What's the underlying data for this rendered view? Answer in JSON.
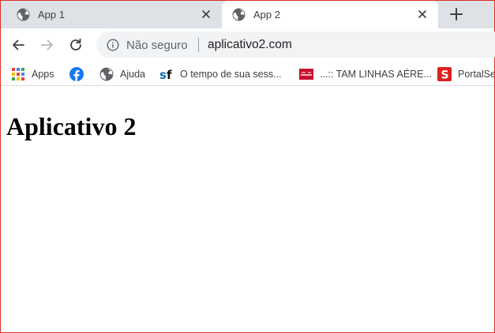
{
  "tabs": [
    {
      "title": "App 1",
      "active": false
    },
    {
      "title": "App 2",
      "active": true
    }
  ],
  "toolbar": {
    "security_text": "Não seguro",
    "url": "aplicativo2.com"
  },
  "bookmarks": [
    {
      "label": "Apps",
      "icon": "apps-grid-icon"
    },
    {
      "label": "",
      "icon": "facebook-icon"
    },
    {
      "label": "Ajuda",
      "icon": "globe-icon"
    },
    {
      "label": "O tempo de sua sess...",
      "icon": "sf-icon"
    },
    {
      "label": "...:: TAM LINHAS AÉRE...",
      "icon": "tam-icon"
    },
    {
      "label": "PortalSe",
      "icon": "s-icon"
    }
  ],
  "page": {
    "heading": "Aplicativo 2"
  },
  "colors": {
    "tabstrip": "#dee1e6",
    "omnibox": "#f1f3f4",
    "frame": "#d93025",
    "facebook": "#1877f2",
    "tam": "#c8102e",
    "portal": "#e02020",
    "sf": "#0a6fb5"
  }
}
